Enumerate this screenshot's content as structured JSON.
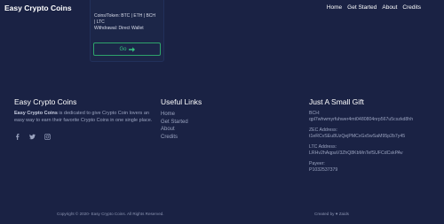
{
  "navbar": {
    "brand": "Easy Crypto Coins",
    "links": [
      "Home",
      "Get Started",
      "About",
      "Credits"
    ]
  },
  "card": {
    "coins_line1": "Coins/Token: BTC | ETH | BCH",
    "coins_line2": "| LTC",
    "withdrawal": "Withdrawal: Direct Wallet",
    "button_label": "Go",
    "accent": "#2ea36b"
  },
  "footer": {
    "about": {
      "title": "Easy Crypto Coins",
      "brand_bold": "Easy Crypto Coins",
      "description": " is dedicated to give Crypto Coin lovers an easy way to earn their favorite Crypto Coins in one single place.",
      "social_icons": [
        "facebook-icon",
        "twitter-icon",
        "instagram-icon"
      ]
    },
    "useful_links": {
      "title": "Useful Links",
      "items": [
        "Home",
        "Get Started",
        "About",
        "Credits"
      ]
    },
    "gift": {
      "title": "Just A Small Gift",
      "entries": [
        {
          "label": "BCH:",
          "value": "qpl7whwmyrfuhwer4mt0480804nrp567u5cszkd8hh"
        },
        {
          "label": "ZEC Address:",
          "value": "t1eRCvSEu8UzQejPMCxGx5wSaM95p2b7y45"
        },
        {
          "label": "LTC Address:",
          "value": "LRHv2hAqpaV3ZhQ8KbMnTefSUFCdCskPAv"
        },
        {
          "label": "Payeer:",
          "value": "P1032537379"
        }
      ]
    },
    "copyright": "Copyright © 2020- Easy Crypto Coins. All Rights Reserved.",
    "credit": "Created by ♥ Zaids"
  },
  "colors": {
    "background": "#1a2244",
    "muted_text": "#9aa3bf"
  }
}
